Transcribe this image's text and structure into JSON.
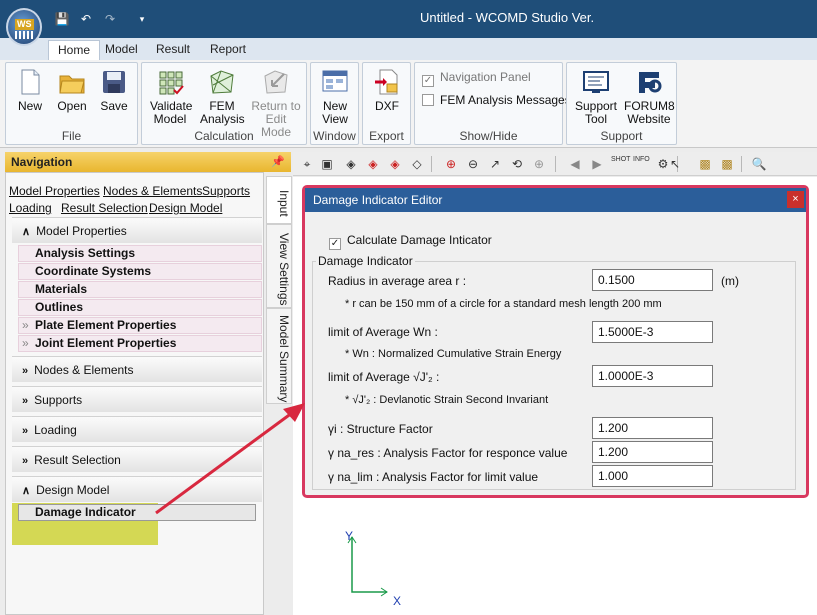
{
  "titlebar": {
    "logo_text": "WS",
    "title": "Untitled - WCOMD Studio Ver.",
    "quick": [
      "save-icon",
      "undo-icon",
      "redo-icon",
      "customize-icon"
    ]
  },
  "tabs": [
    "Home",
    "Model",
    "Result",
    "Report"
  ],
  "ribbon": {
    "file": {
      "label": "File",
      "new": "New",
      "open": "Open",
      "save": "Save"
    },
    "calculation": {
      "label": "Calculation",
      "validate": "Validate Model",
      "fem": "FEM Analysis",
      "return": "Return to Edit Mode"
    },
    "window": {
      "label": "Window",
      "new_view": "New View"
    },
    "export": {
      "label": "Export",
      "dxf": "DXF"
    },
    "showhide": {
      "label": "Show/Hide",
      "nav_panel": "Navigation Panel",
      "fem_msgs": "FEM Analysis Messages"
    },
    "support": {
      "label": "Support",
      "tool": "Support Tool",
      "forum": "FORUM8 Website"
    }
  },
  "navigation": {
    "header": "Navigation",
    "links": [
      "Model Properties",
      "Nodes & Elements",
      "Supports",
      "Loading",
      "Result Selection",
      "Design Model"
    ],
    "sections": {
      "model_properties": "Model Properties",
      "nodes": "Nodes & Elements",
      "supports": "Supports",
      "loading": "Loading",
      "result": "Result Selection",
      "design": "Design Model"
    },
    "items": [
      "Analysis Settings",
      "Coordinate Systems",
      "Materials",
      "Outlines",
      "Plate Element Properties",
      "Joint Element Properties"
    ],
    "design_item": "Damage Indicator"
  },
  "vtabs": [
    "Input",
    "View Settings",
    "Model Summary"
  ],
  "dialog": {
    "title": "Damage Indicator Editor",
    "calc_label": "Calculate Damage Inticator",
    "group_label": "Damage Indicator",
    "radius_label": "Radius in average area r :",
    "radius_value": "0.1500",
    "radius_unit": "(m)",
    "radius_note": "* r can be 150 mm of a circle for a standard mesh length 200 mm",
    "wn_label": "limit of Average Wn :",
    "wn_value": "1.5000E-3",
    "wn_note": "* Wn : Normalized Cumulative Strain Energy",
    "j2_label": "limit of Average √J'₂ :",
    "j2_value": "1.0000E-3",
    "j2_note": "* √J'₂ : Devlanotic Strain Second Invariant",
    "gi_label": "γi : Structure Factor",
    "gi_value": "1.200",
    "gres_label": "γ na_res : Analysis Factor for responce value",
    "gres_value": "1.200",
    "glim_label": "γ na_lim : Analysis Factor for limit value",
    "glim_value": "1.000"
  },
  "axes": {
    "y": "Y",
    "x": "X"
  }
}
